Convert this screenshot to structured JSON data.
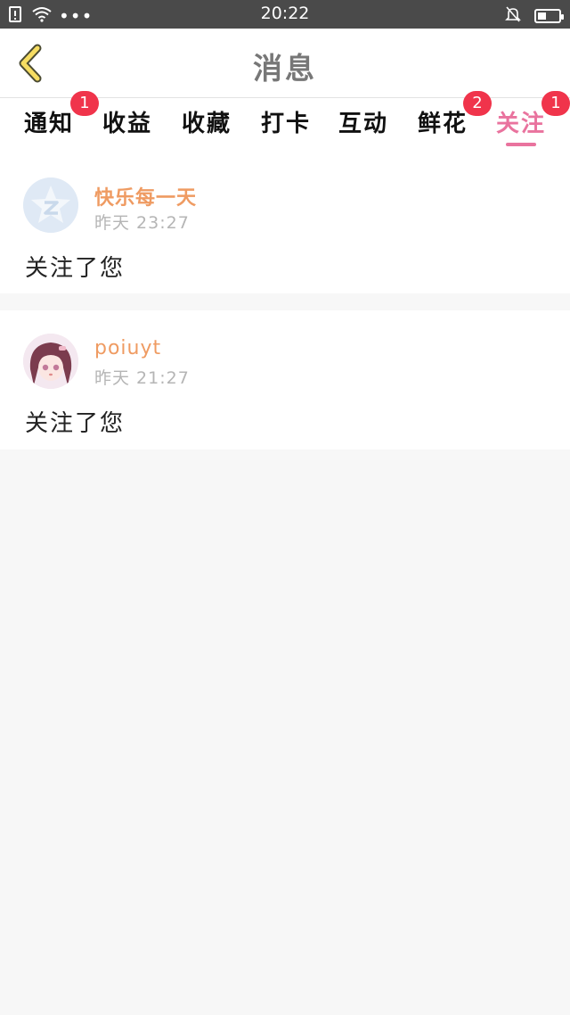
{
  "status_bar": {
    "time": "20:22",
    "battery_level": 0.4,
    "icons": [
      "sim-alert-icon",
      "wifi-icon",
      "more-dots-icon",
      "silent-bell-icon",
      "battery-icon"
    ]
  },
  "header": {
    "title": "消息",
    "back_icon": "chevron-left-icon"
  },
  "tabs": [
    {
      "label": "通知",
      "badge": "1",
      "active": false
    },
    {
      "label": "收益",
      "badge": "",
      "active": false
    },
    {
      "label": "收藏",
      "badge": "",
      "active": false
    },
    {
      "label": "打卡",
      "badge": "",
      "active": false
    },
    {
      "label": "互动",
      "badge": "",
      "active": false
    },
    {
      "label": "鲜花",
      "badge": "2",
      "active": false
    },
    {
      "label": "关注",
      "badge": "1",
      "active": true
    }
  ],
  "accent_color": "#e9739e",
  "badge_color": "#f0344b",
  "notifications": [
    {
      "username": "快乐每一天",
      "time": "昨天 23:27",
      "message": "关注了您",
      "avatar": "default-qzone-avatar"
    },
    {
      "username": "poiuyt",
      "time": "昨天 21:27",
      "message": "关注了您",
      "avatar": "anime-girl-avatar"
    }
  ]
}
